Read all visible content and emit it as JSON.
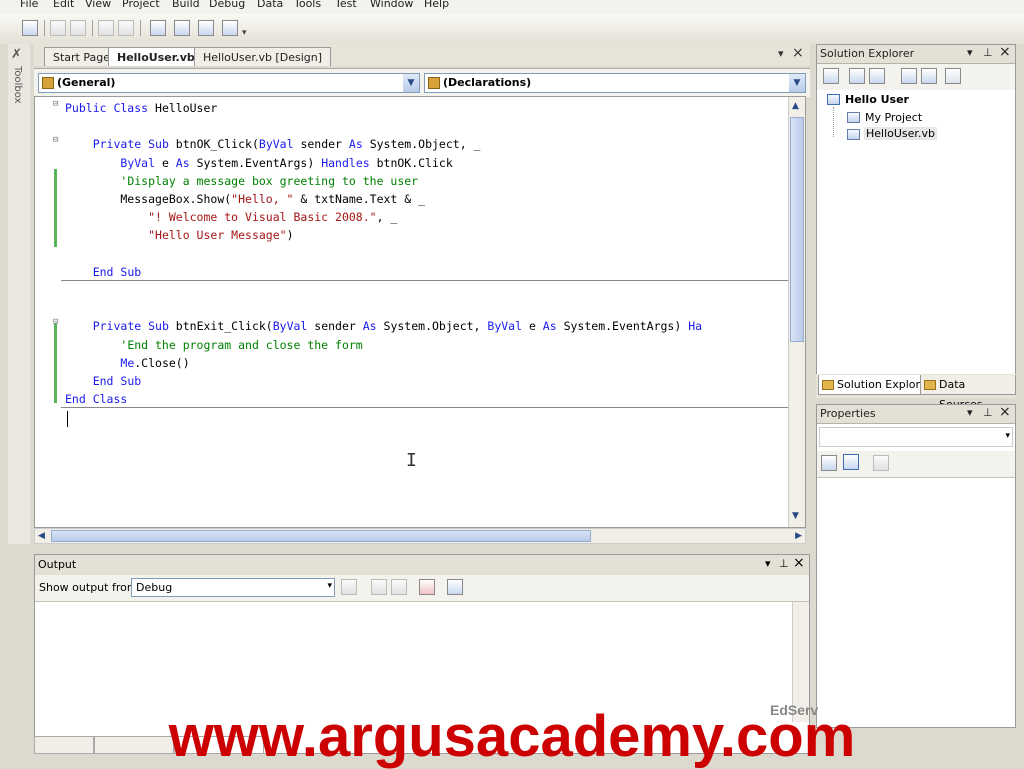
{
  "menu": [
    "File",
    "Edit",
    "View",
    "Project",
    "Build",
    "Debug",
    "Data",
    "Tools",
    "Test",
    "Window",
    "Help"
  ],
  "toolbox_label": "Toolbox",
  "document_tabs": [
    {
      "label": "Start Page",
      "active": false
    },
    {
      "label": "HelloUser.vb",
      "active": true
    },
    {
      "label": "HelloUser.vb [Design]",
      "active": false
    }
  ],
  "panel_controls": {
    "dropdown": "▾",
    "close": "×",
    "pin": "⊥"
  },
  "editor": {
    "class_combo": "(General)",
    "method_combo": "(Declarations)",
    "code_lines": [
      [
        {
          "t": "kw",
          "v": "Public Class "
        },
        {
          "t": "tx",
          "v": "HelloUser"
        }
      ],
      [],
      [
        {
          "t": "tx",
          "v": "    "
        },
        {
          "t": "kw",
          "v": "Private Sub "
        },
        {
          "t": "tx",
          "v": "btnOK_Click("
        },
        {
          "t": "kw",
          "v": "ByVal "
        },
        {
          "t": "tx",
          "v": "sender "
        },
        {
          "t": "kw",
          "v": "As "
        },
        {
          "t": "tx",
          "v": "System.Object, _"
        }
      ],
      [
        {
          "t": "tx",
          "v": "        "
        },
        {
          "t": "kw",
          "v": "ByVal "
        },
        {
          "t": "tx",
          "v": "e "
        },
        {
          "t": "kw",
          "v": "As "
        },
        {
          "t": "tx",
          "v": "System.EventArgs) "
        },
        {
          "t": "kw",
          "v": "Handles "
        },
        {
          "t": "tx",
          "v": "btnOK.Click"
        }
      ],
      [
        {
          "t": "tx",
          "v": "        "
        },
        {
          "t": "cm",
          "v": "'Display a message box greeting to the user"
        }
      ],
      [
        {
          "t": "tx",
          "v": "        MessageBox.Show("
        },
        {
          "t": "str",
          "v": "\"Hello, \""
        },
        {
          "t": "tx",
          "v": " & txtName.Text & _"
        }
      ],
      [
        {
          "t": "tx",
          "v": "            "
        },
        {
          "t": "str",
          "v": "\"! Welcome to Visual Basic 2008.\""
        },
        {
          "t": "tx",
          "v": ", _"
        }
      ],
      [
        {
          "t": "tx",
          "v": "            "
        },
        {
          "t": "str",
          "v": "\"Hello User Message\""
        },
        {
          "t": "tx",
          "v": ")"
        }
      ],
      [],
      [
        {
          "t": "tx",
          "v": "    "
        },
        {
          "t": "kw",
          "v": "End Sub"
        }
      ],
      [],
      [],
      [
        {
          "t": "tx",
          "v": "    "
        },
        {
          "t": "kw",
          "v": "Private Sub "
        },
        {
          "t": "tx",
          "v": "btnExit_Click("
        },
        {
          "t": "kw",
          "v": "ByVal "
        },
        {
          "t": "tx",
          "v": "sender "
        },
        {
          "t": "kw",
          "v": "As "
        },
        {
          "t": "tx",
          "v": "System.Object, "
        },
        {
          "t": "kw",
          "v": "ByVal "
        },
        {
          "t": "tx",
          "v": "e "
        },
        {
          "t": "kw",
          "v": "As "
        },
        {
          "t": "tx",
          "v": "System.EventArgs) "
        },
        {
          "t": "kw",
          "v": "Ha"
        }
      ],
      [
        {
          "t": "tx",
          "v": "        "
        },
        {
          "t": "cm",
          "v": "'End the program and close the form"
        }
      ],
      [
        {
          "t": "tx",
          "v": "        "
        },
        {
          "t": "kw",
          "v": "Me"
        },
        {
          "t": "tx",
          "v": ".Close()"
        }
      ],
      [
        {
          "t": "tx",
          "v": "    "
        },
        {
          "t": "kw",
          "v": "End Sub"
        }
      ],
      [
        {
          "t": "kw",
          "v": "End Class"
        }
      ]
    ]
  },
  "output": {
    "title": "Output",
    "show_from_label": "Show output from:",
    "show_from_value": "Debug"
  },
  "solution_explorer": {
    "title": "Solution Explorer",
    "project": "Hello User",
    "items": [
      "My Project",
      "HelloUser.vb"
    ]
  },
  "bottom_tabs": [
    {
      "label": "Solution Explorer",
      "active": true
    },
    {
      "label": "Data Sources",
      "active": false
    }
  ],
  "properties": {
    "title": "Properties"
  },
  "watermark": {
    "text": "www.argusacademy.com",
    "color": "#cc0000"
  },
  "edserv_text": "EdServ",
  "colors": {
    "keyword": "#1a1af0",
    "string": "#a31515",
    "comment": "#008000"
  }
}
